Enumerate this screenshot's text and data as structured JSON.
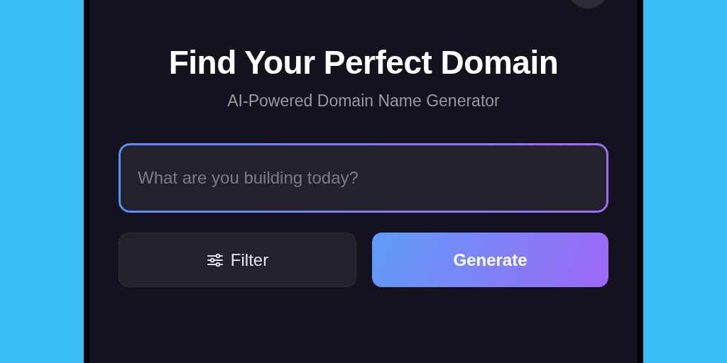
{
  "heading": {
    "title": "Find Your Perfect Domain",
    "subtitle": "AI-Powered Domain Name Generator"
  },
  "search": {
    "placeholder": "What are you building today?"
  },
  "buttons": [
    {
      "kind": "secondary",
      "label": "Filter"
    },
    {
      "kind": "primary",
      "label": "Generate"
    }
  ]
}
